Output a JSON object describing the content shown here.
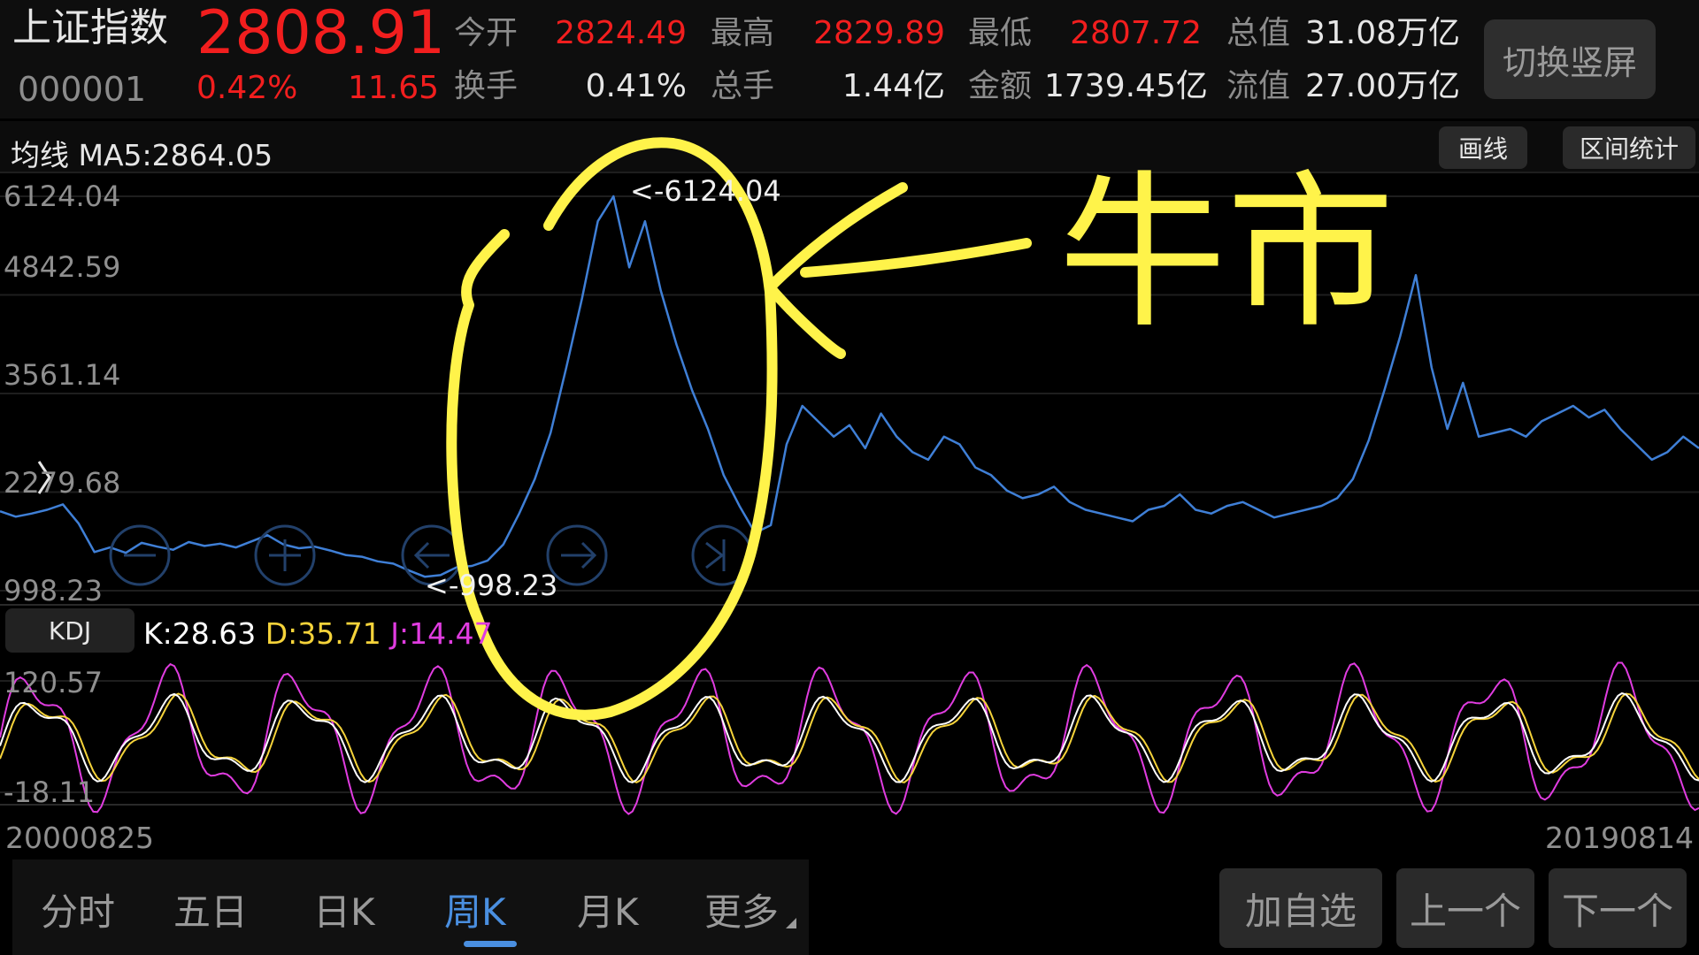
{
  "quote": {
    "name": "上证指数",
    "code": "000001",
    "price": "2808.91",
    "change_pct": "0.42%",
    "change": "11.65",
    "labels": {
      "open": "今开",
      "high": "最高",
      "low": "最低",
      "mktcap": "总值",
      "turnover": "换手",
      "volume": "总手",
      "amount": "金额",
      "float_cap": "流值"
    },
    "values": {
      "open": "2824.49",
      "high": "2829.89",
      "low": "2807.72",
      "mktcap": "31.08万亿",
      "turnover": "0.41%",
      "volume": "1.44亿",
      "amount": "1739.45亿",
      "float_cap": "27.00万亿"
    },
    "switch_label": "切换竖屏"
  },
  "ma": {
    "label": "均线 MA5:2864.05"
  },
  "tools": {
    "draw_line": "画线",
    "range_stats": "区间统计"
  },
  "kdj": {
    "label": "KDJ",
    "k": "K:28.63",
    "d": "D:35.71",
    "j": "J:14.47"
  },
  "dates": {
    "start": "20000825",
    "end": "20190814"
  },
  "annotation": {
    "text": "牛市",
    "color": "#fff34a"
  },
  "nav": {
    "items": [
      "分时",
      "五日",
      "日K",
      "周K",
      "月K",
      "更多"
    ],
    "active_index": 3
  },
  "actions": {
    "add": "加自选",
    "prev": "上一个",
    "next": "下一个"
  },
  "colors": {
    "up": "#f21e1e",
    "line": "#3f7fd6",
    "k": "#ffffff",
    "d": "#f5d33a",
    "j": "#e03ce0",
    "active": "#4a8fe0"
  },
  "chart_data": [
    {
      "type": "line",
      "series": [
        {
          "name": "上证指数",
          "values": [
            2030,
            1960,
            2000,
            2050,
            2120,
            1870,
            1500,
            1560,
            1490,
            1620,
            1570,
            1530,
            1630,
            1580,
            1610,
            1560,
            1640,
            1720,
            1600,
            1550,
            1570,
            1520,
            1460,
            1440,
            1380,
            1350,
            1260,
            1180,
            1200,
            1300,
            1320,
            1390,
            1600,
            2000,
            2450,
            3050,
            3900,
            4800,
            5800,
            6124.04,
            5200,
            5800,
            4900,
            4200,
            3600,
            3100,
            2500,
            2100,
            1750,
            1850,
            2900,
            3400,
            3200,
            3000,
            3150,
            2850,
            3300,
            3000,
            2800,
            2700,
            3000,
            2900,
            2600,
            2500,
            2300,
            2200,
            2250,
            2350,
            2150,
            2050,
            2000,
            1950,
            1900,
            2050,
            2100,
            2250,
            2050,
            2000,
            2100,
            2150,
            2050,
            1950,
            2000,
            2050,
            2100,
            2200,
            2450,
            2950,
            3600,
            4300,
            5100,
            3900,
            3100,
            3700,
            3000,
            3050,
            3100,
            3000,
            3200,
            3300,
            3400,
            3250,
            3350,
            3100,
            2900,
            2700,
            2800,
            3000,
            2850
          ]
        }
      ],
      "ylim": [
        998.23,
        6124.04
      ],
      "y_ticks": [
        "6124.04",
        "4842.59",
        "3561.14",
        "2279.68",
        "998.23"
      ],
      "max_label": "<-6124.04",
      "min_label": "<-998.23",
      "x_range": [
        "20000825",
        "20190814"
      ]
    },
    {
      "type": "line",
      "y_ticks": [
        "120.57",
        "-18.11"
      ],
      "ylim": [
        -18.11,
        120.57
      ],
      "series_names": [
        "K",
        "D",
        "J"
      ],
      "last_values": {
        "K": 28.63,
        "D": 35.71,
        "J": 14.47
      }
    }
  ]
}
